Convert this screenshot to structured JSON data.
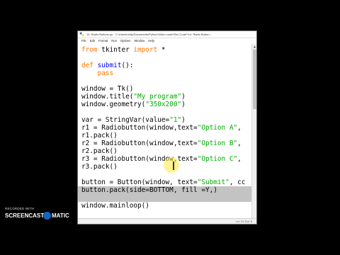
{
  "window": {
    "title": "14. Radio Buttons.py - C:\\Users\\reilly\\Documents\\Python\\Video code\\*Bro Code*\\14. Radio Button...",
    "menu": [
      "File",
      "Edit",
      "Format",
      "Run",
      "Options",
      "Window",
      "Help"
    ],
    "status": "Ln: 21  Col: 0"
  },
  "code": [
    {
      "parts": [
        {
          "t": "from",
          "c": "kw"
        },
        {
          "t": " tkinter "
        },
        {
          "t": "import",
          "c": "kw"
        },
        {
          "t": " *"
        }
      ]
    },
    {
      "parts": []
    },
    {
      "parts": [
        {
          "t": "def",
          "c": "kw"
        },
        {
          "t": " "
        },
        {
          "t": "submit",
          "c": "fn"
        },
        {
          "t": "():"
        }
      ]
    },
    {
      "parts": [
        {
          "t": "    "
        },
        {
          "t": "pass",
          "c": "kw"
        }
      ]
    },
    {
      "parts": []
    },
    {
      "parts": [
        {
          "t": "window = Tk()"
        }
      ]
    },
    {
      "parts": [
        {
          "t": "window.title("
        },
        {
          "t": "\"My program\"",
          "c": "str"
        },
        {
          "t": ")"
        }
      ]
    },
    {
      "parts": [
        {
          "t": "window.geometry("
        },
        {
          "t": "\"350x200\"",
          "c": "str"
        },
        {
          "t": ")"
        }
      ]
    },
    {
      "parts": []
    },
    {
      "parts": [
        {
          "t": "var = StringVar(value="
        },
        {
          "t": "\"1\"",
          "c": "str"
        },
        {
          "t": ")"
        }
      ]
    },
    {
      "parts": [
        {
          "t": "r1 = Radiobutton(window,text="
        },
        {
          "t": "\"Option A\"",
          "c": "str"
        },
        {
          "t": ","
        }
      ]
    },
    {
      "parts": [
        {
          "t": "r1.pack()"
        }
      ]
    },
    {
      "parts": [
        {
          "t": "r2 = Radiobutton(window,text="
        },
        {
          "t": "\"Option B\"",
          "c": "str"
        },
        {
          "t": ","
        }
      ]
    },
    {
      "parts": [
        {
          "t": "r2.pack()"
        }
      ]
    },
    {
      "parts": [
        {
          "t": "r3 = Radiobutton(window,text="
        },
        {
          "t": "\"Option C\"",
          "c": "str"
        },
        {
          "t": ","
        }
      ]
    },
    {
      "parts": [
        {
          "t": "r3.pack()"
        }
      ]
    },
    {
      "parts": []
    },
    {
      "parts": [
        {
          "t": "button = Button(window, text="
        },
        {
          "t": "\"Submit\"",
          "c": "str"
        },
        {
          "t": ", cc"
        }
      ]
    },
    {
      "parts": [
        {
          "t": "button.pack(side=BOTTOM, fill =Y,)"
        }
      ]
    },
    {
      "parts": []
    },
    {
      "parts": [
        {
          "t": "window.mainloop()"
        }
      ]
    }
  ],
  "watermark": {
    "recorded": "RECORDED WITH",
    "brand_left": "SCREENCAST",
    "brand_right": "MATIC"
  }
}
